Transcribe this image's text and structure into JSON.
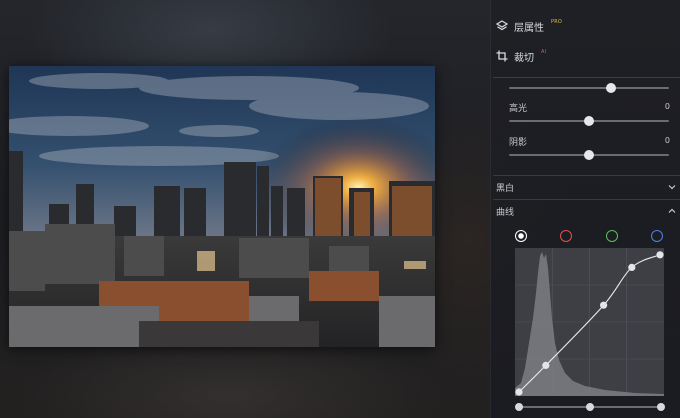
{
  "panel": {
    "layers": {
      "label": "层属性",
      "badge": "PRO",
      "icon": "layers-icon"
    },
    "crop": {
      "label": "裁切",
      "badge": "AI",
      "icon": "crop-icon"
    },
    "adjust": {
      "top_slider": {
        "level": 0.64
      },
      "highlights": {
        "label": "高光",
        "value": "0",
        "level": 0.5
      },
      "shadows": {
        "label": "阴影",
        "value": "0",
        "level": 0.5
      }
    },
    "bw": {
      "label": "黑白",
      "icon": "chevron-down-icon"
    },
    "curves": {
      "label": "曲线",
      "icon": "chevron-up-icon",
      "channels": [
        {
          "name": "rgb",
          "color": "#ffffff",
          "active": true
        },
        {
          "name": "red",
          "color": "#e0524a",
          "active": false
        },
        {
          "name": "green",
          "color": "#5cbf58",
          "active": false
        },
        {
          "name": "blue",
          "color": "#4f7fe6",
          "active": false
        }
      ],
      "points": [
        [
          0,
          0
        ],
        [
          0.19,
          0.19
        ],
        [
          0.6,
          0.62
        ],
        [
          0.8,
          0.89
        ],
        [
          1,
          0.98
        ]
      ],
      "range": {
        "black": 0,
        "mid": 0.5,
        "white": 1
      }
    }
  }
}
